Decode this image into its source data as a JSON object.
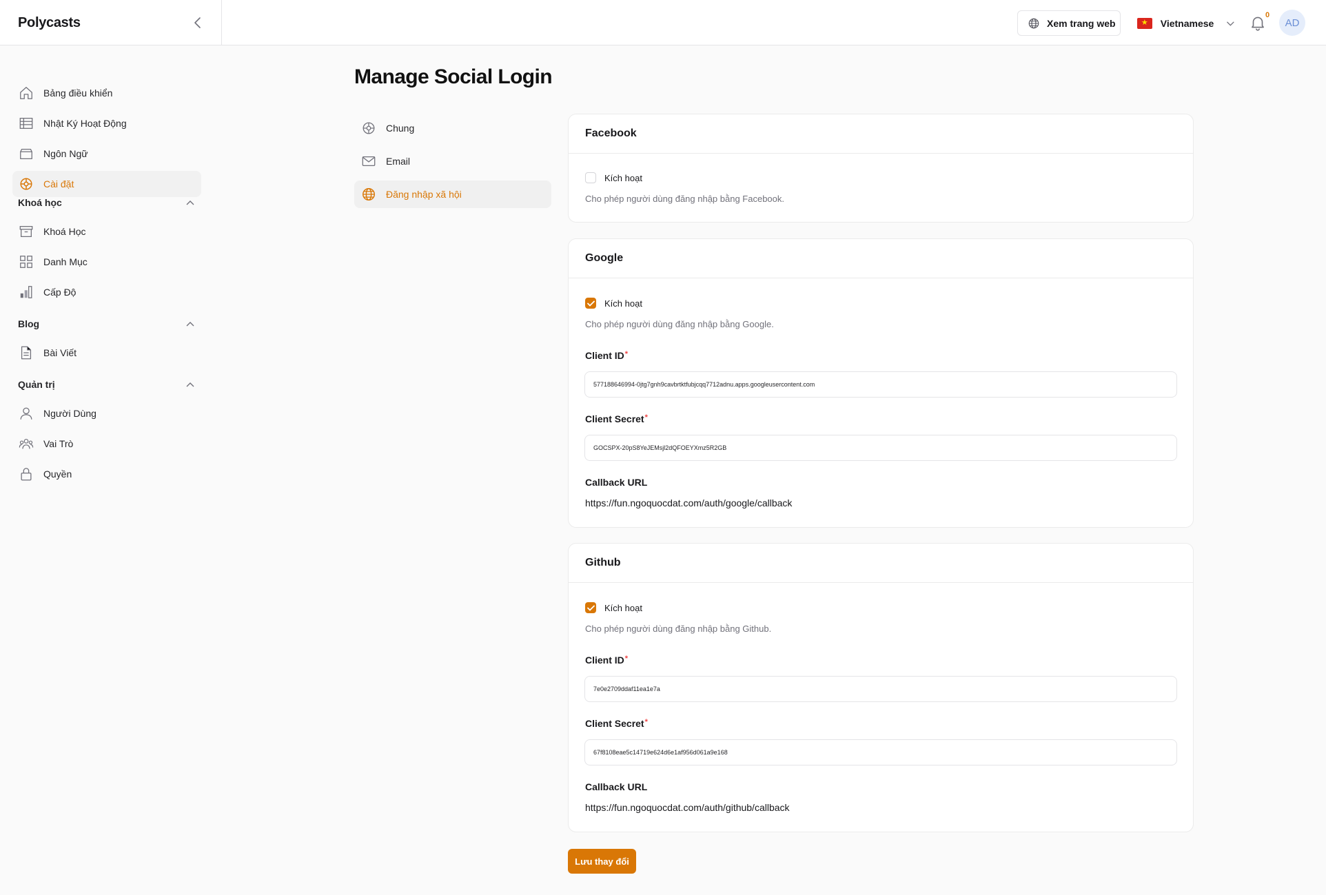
{
  "header": {
    "brand": "Polycasts",
    "view_site": "Xem trang web",
    "language": "Vietnamese",
    "notification_count": "0",
    "avatar_initials": "AD"
  },
  "sidebar": {
    "top_items": [
      {
        "label": "Bảng điều khiển",
        "icon": "home-icon"
      },
      {
        "label": "Nhật Ký Hoạt Động",
        "icon": "table-icon"
      },
      {
        "label": "Ngôn Ngữ",
        "icon": "inbox-icon"
      },
      {
        "label": "Cài đặt",
        "icon": "settings-icon",
        "active": true
      }
    ],
    "sections": [
      {
        "title": "Khoá học",
        "items": [
          {
            "label": "Khoá Học",
            "icon": "archive-icon"
          },
          {
            "label": "Danh Mục",
            "icon": "grid-icon"
          },
          {
            "label": "Cấp Độ",
            "icon": "bar-chart-icon"
          }
        ]
      },
      {
        "title": "Blog",
        "items": [
          {
            "label": "Bài Viết",
            "icon": "document-icon"
          }
        ]
      },
      {
        "title": "Quản trị",
        "items": [
          {
            "label": "Người Dùng",
            "icon": "user-icon"
          },
          {
            "label": "Vai Trò",
            "icon": "users-icon"
          },
          {
            "label": "Quyền",
            "icon": "lock-icon"
          }
        ]
      }
    ]
  },
  "main": {
    "title": "Manage Social Login",
    "sub_nav": [
      {
        "label": "Chung",
        "icon": "settings-icon"
      },
      {
        "label": "Email",
        "icon": "mail-icon"
      },
      {
        "label": "Đăng nhập xã hội",
        "icon": "globe-icon",
        "active": true
      }
    ],
    "providers": {
      "facebook": {
        "title": "Facebook",
        "enabled": false,
        "enable_label": "Kích hoạt",
        "help": "Cho phép người dùng đăng nhập bằng Facebook."
      },
      "google": {
        "title": "Google",
        "enabled": true,
        "enable_label": "Kích hoạt",
        "help": "Cho phép người dùng đăng nhập bằng Google.",
        "client_id_label": "Client ID",
        "client_id": "577188646994-0jtg7gnh9cavbrtktfubjcqq7712adnu.apps.googleusercontent.com",
        "client_secret_label": "Client Secret",
        "client_secret": "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",
        "callback_label": "Callback URL",
        "callback_url": "https://fun.ngoquocdat.com/auth/google/callback"
      },
      "github": {
        "title": "Github",
        "enabled": true,
        "enable_label": "Kích hoạt",
        "help": "Cho phép người dùng đăng nhập bằng Github.",
        "client_id_label": "Client ID",
        "client_id": "7e0e2709ddaf11ea1e7a",
        "client_secret_label": "Client Secret",
        "client_secret": "67f8108eae5c14719e624d6e1af956d061a9e168",
        "callback_label": "Callback URL",
        "callback_url": "https://fun.ngoquocdat.com/auth/github/callback"
      }
    },
    "save_label": "Lưu thay đổi"
  },
  "colors": {
    "accent": "#d97706",
    "required": "#ef4444"
  }
}
